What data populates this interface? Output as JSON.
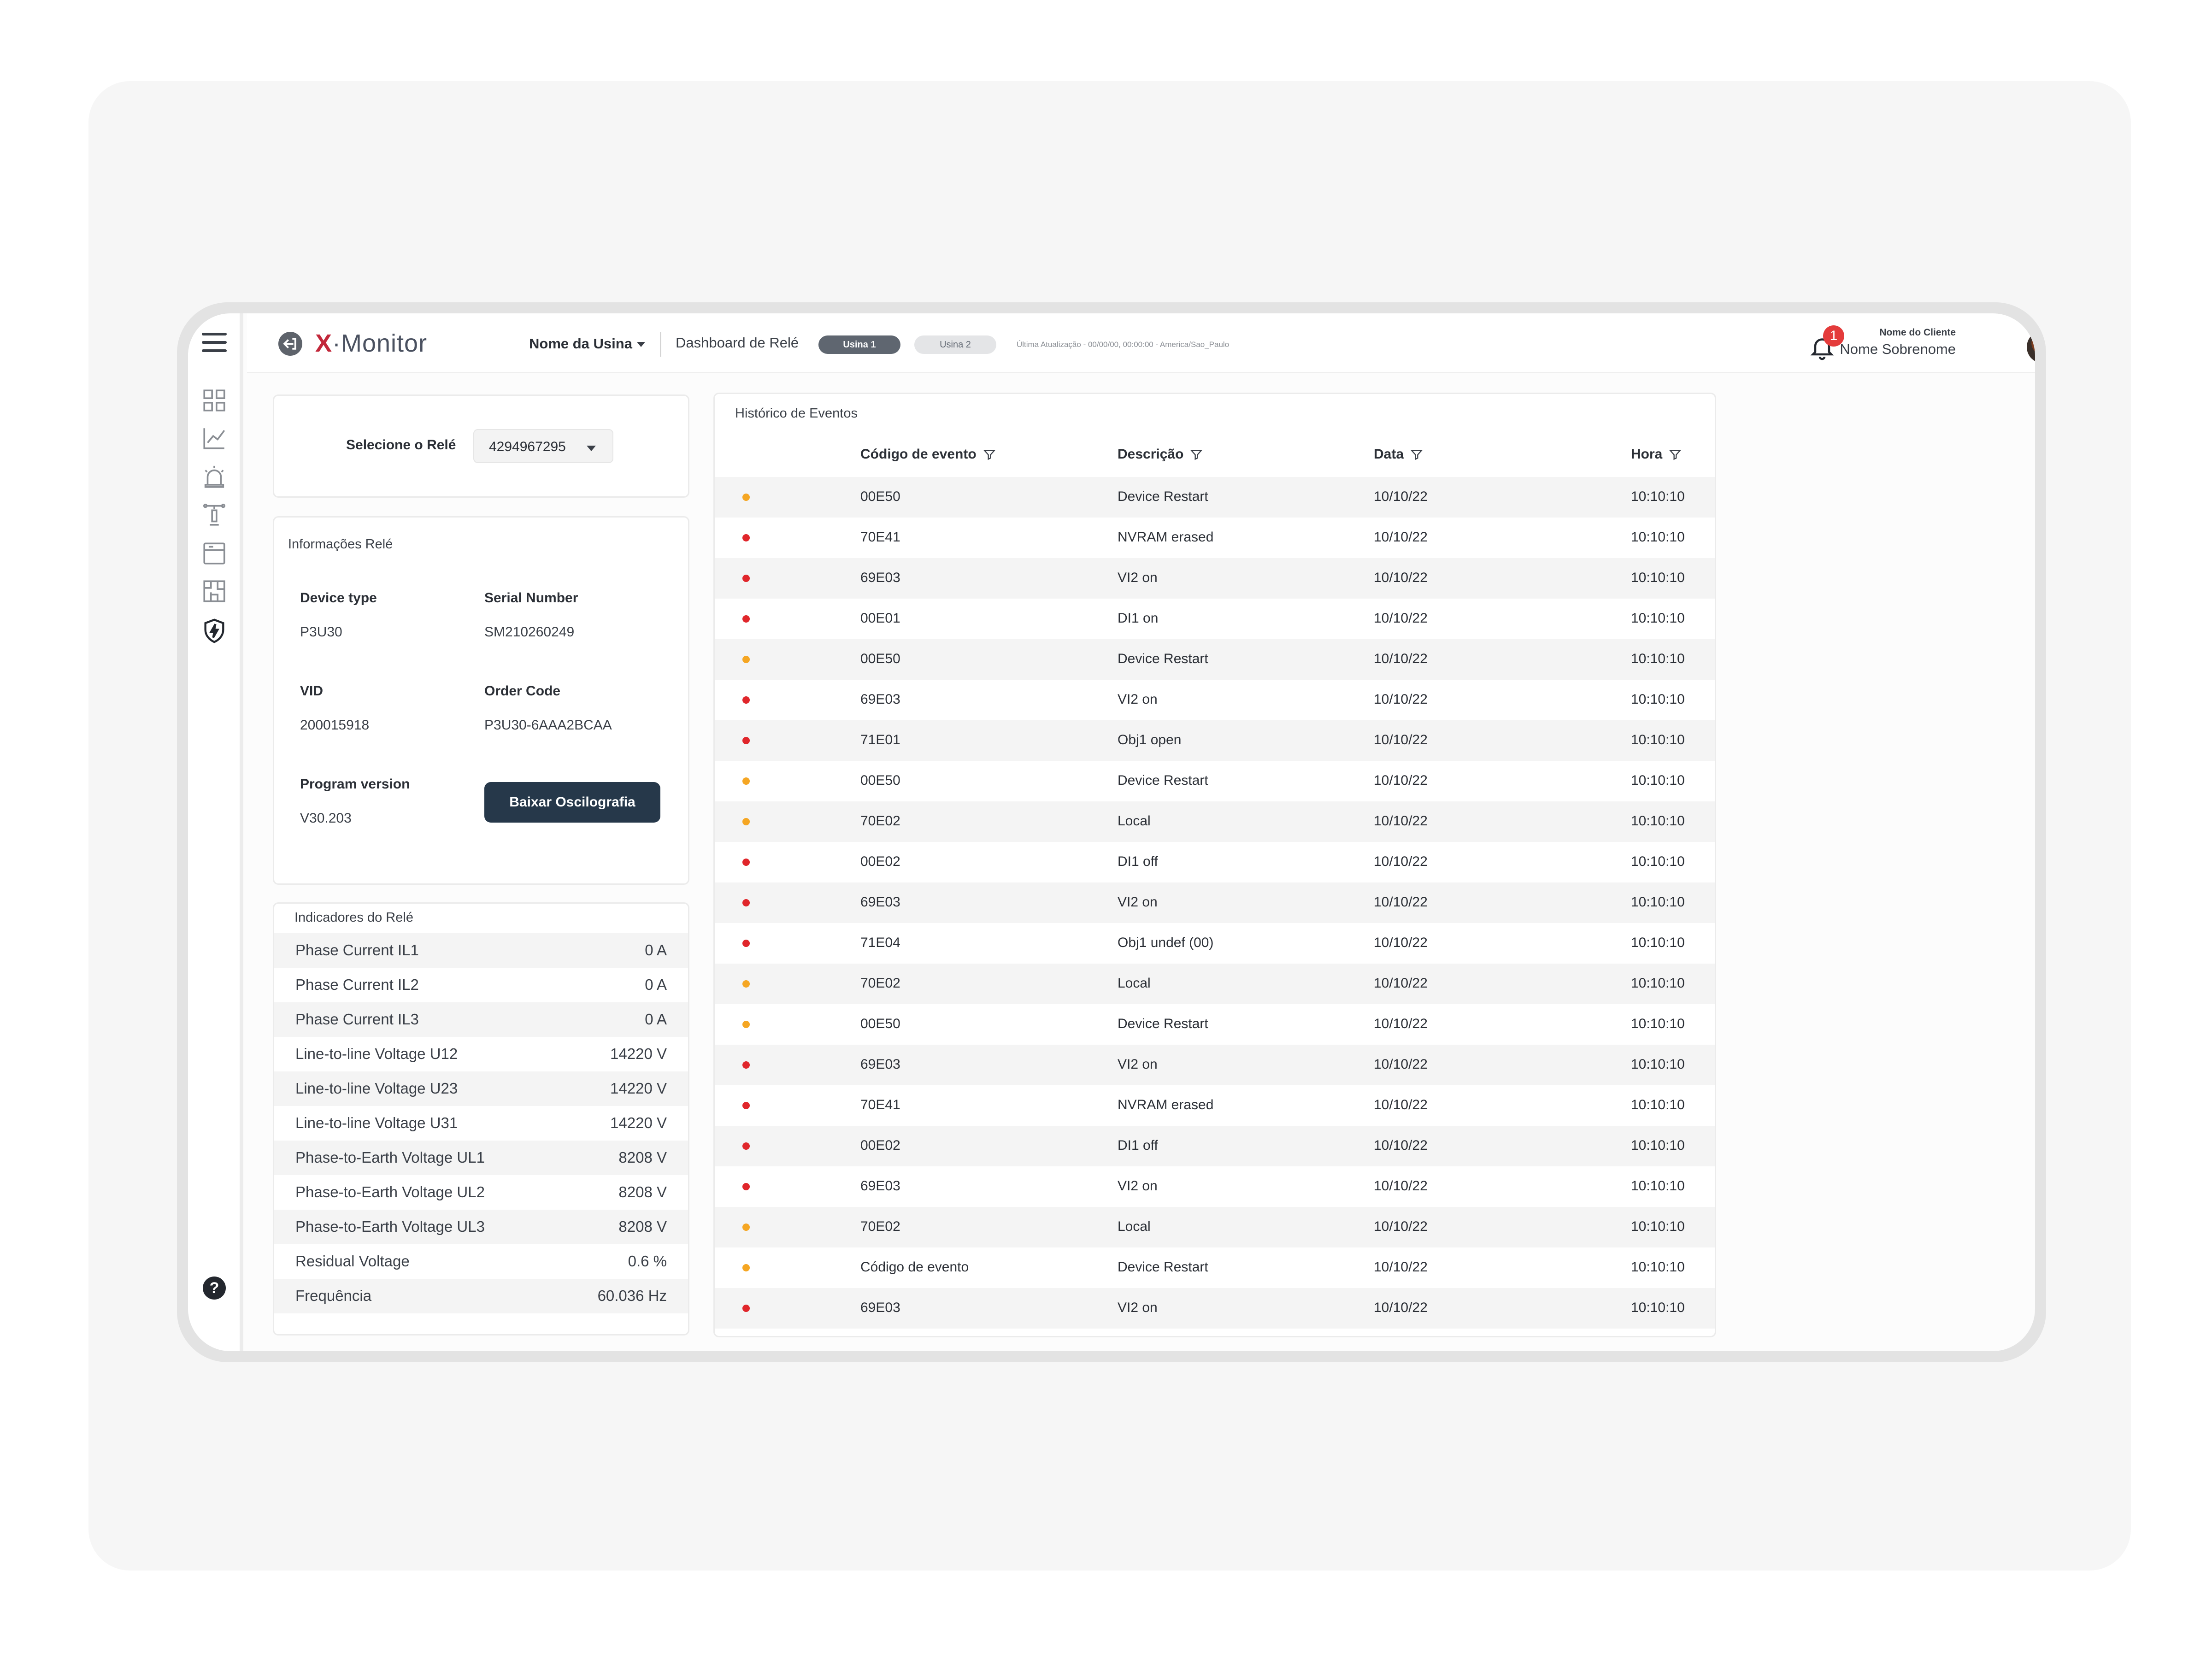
{
  "header": {
    "logo_prefix": "X",
    "logo_suffix": "·Monitor",
    "plant_select": "Nome da Usina",
    "dashboard_title": "Dashboard de Relé",
    "tabs": [
      "Usina 1",
      "Usina 2"
    ],
    "last_update": "Última Atualização - 00/00/00, 00:00:00 - America/Sao_Paulo",
    "notification_count": "1",
    "client_label": "Nome do Cliente",
    "user_name": "Nome Sobrenome"
  },
  "sidebar": {
    "icons": [
      "grid-icon",
      "line-chart-icon",
      "alarm-icon",
      "tower-icon",
      "panel-icon",
      "floorplan-icon",
      "shield-icon"
    ],
    "help": "?"
  },
  "relay_select": {
    "label": "Selecione o Relé",
    "value": "4294967295"
  },
  "relay_info": {
    "title": "Informações Relé",
    "device_type_label": "Device type",
    "device_type_value": "P3U30",
    "serial_label": "Serial Number",
    "serial_value": "SM210260249",
    "vid_label": "VID",
    "vid_value": "200015918",
    "order_label": "Order Code",
    "order_value": "P3U30-6AAA2BCAA",
    "program_label": "Program version",
    "program_value": "V30.203",
    "download_button": "Baixar Oscilografia"
  },
  "indicators": {
    "title": "Indicadores do Relé",
    "rows": [
      {
        "name": "Phase Current IL1",
        "value": "0 A"
      },
      {
        "name": "Phase Current IL2",
        "value": "0 A"
      },
      {
        "name": "Phase Current IL3",
        "value": "0 A"
      },
      {
        "name": "Line-to-line Voltage U12",
        "value": "14220 V"
      },
      {
        "name": "Line-to-line Voltage U23",
        "value": "14220 V"
      },
      {
        "name": "Line-to-line Voltage U31",
        "value": "14220 V"
      },
      {
        "name": "Phase-to-Earth Voltage UL1",
        "value": "8208 V"
      },
      {
        "name": "Phase-to-Earth Voltage UL2",
        "value": "8208 V"
      },
      {
        "name": "Phase-to-Earth Voltage UL3",
        "value": "8208 V"
      },
      {
        "name": "Residual Voltage",
        "value": "0.6 %"
      },
      {
        "name": "Frequência",
        "value": "60.036 Hz"
      }
    ]
  },
  "events": {
    "title": "Histórico de Eventos",
    "columns": [
      "Código de evento",
      "Descrição",
      "Data",
      "Hora"
    ],
    "status_colors": {
      "warning": "#f5a623",
      "error": "#e0262b"
    },
    "rows": [
      {
        "status": "warning",
        "code": "00E50",
        "desc": "Device Restart",
        "date": "10/10/22",
        "time": "10:10:10"
      },
      {
        "status": "error",
        "code": "70E41",
        "desc": "NVRAM erased",
        "date": "10/10/22",
        "time": "10:10:10"
      },
      {
        "status": "error",
        "code": "69E03",
        "desc": "VI2 on",
        "date": "10/10/22",
        "time": "10:10:10"
      },
      {
        "status": "error",
        "code": "00E01",
        "desc": "DI1 on",
        "date": "10/10/22",
        "time": "10:10:10"
      },
      {
        "status": "warning",
        "code": "00E50",
        "desc": "Device Restart",
        "date": "10/10/22",
        "time": "10:10:10"
      },
      {
        "status": "error",
        "code": "69E03",
        "desc": "VI2 on",
        "date": "10/10/22",
        "time": "10:10:10"
      },
      {
        "status": "error",
        "code": "71E01",
        "desc": "Obj1 open",
        "date": "10/10/22",
        "time": "10:10:10"
      },
      {
        "status": "warning",
        "code": "00E50",
        "desc": "Device Restart",
        "date": "10/10/22",
        "time": "10:10:10"
      },
      {
        "status": "warning",
        "code": "70E02",
        "desc": "Local",
        "date": "10/10/22",
        "time": "10:10:10"
      },
      {
        "status": "error",
        "code": "00E02",
        "desc": "DI1 off",
        "date": "10/10/22",
        "time": "10:10:10"
      },
      {
        "status": "error",
        "code": "69E03",
        "desc": "VI2 on",
        "date": "10/10/22",
        "time": "10:10:10"
      },
      {
        "status": "error",
        "code": "71E04",
        "desc": "Obj1 undef (00)",
        "date": "10/10/22",
        "time": "10:10:10"
      },
      {
        "status": "warning",
        "code": "70E02",
        "desc": "Local",
        "date": "10/10/22",
        "time": "10:10:10"
      },
      {
        "status": "warning",
        "code": "00E50",
        "desc": "Device Restart",
        "date": "10/10/22",
        "time": "10:10:10"
      },
      {
        "status": "error",
        "code": "69E03",
        "desc": "VI2 on",
        "date": "10/10/22",
        "time": "10:10:10"
      },
      {
        "status": "error",
        "code": "70E41",
        "desc": "NVRAM erased",
        "date": "10/10/22",
        "time": "10:10:10"
      },
      {
        "status": "error",
        "code": "00E02",
        "desc": "DI1 off",
        "date": "10/10/22",
        "time": "10:10:10"
      },
      {
        "status": "error",
        "code": "69E03",
        "desc": "VI2 on",
        "date": "10/10/22",
        "time": "10:10:10"
      },
      {
        "status": "warning",
        "code": "70E02",
        "desc": "Local",
        "date": "10/10/22",
        "time": "10:10:10"
      },
      {
        "status": "warning",
        "code": "Código de evento",
        "desc": "Device Restart",
        "date": "10/10/22",
        "time": "10:10:10"
      },
      {
        "status": "error",
        "code": "69E03",
        "desc": "VI2 on",
        "date": "10/10/22",
        "time": "10:10:10"
      }
    ]
  }
}
